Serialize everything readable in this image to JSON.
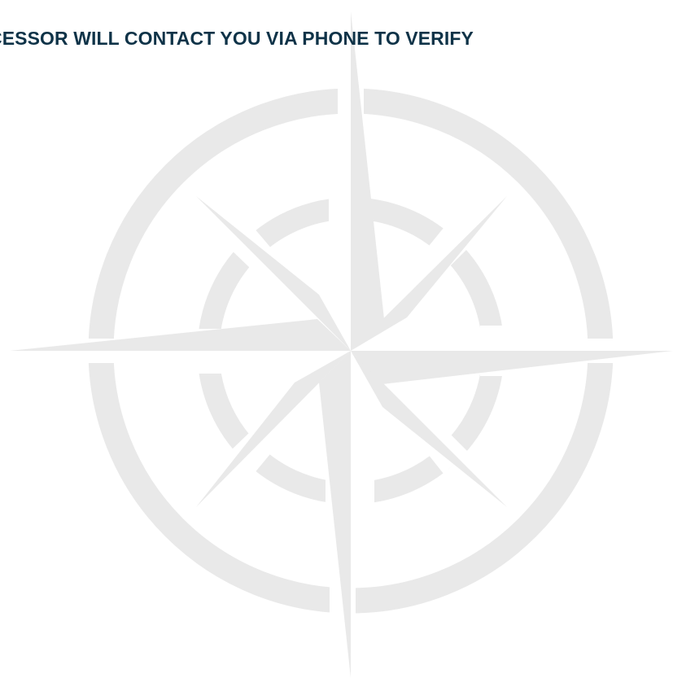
{
  "banner": {
    "text": "CESSOR WILL CONTACT YOU VIA PHONE TO VERIFY"
  },
  "watermark": {
    "icon": "compass-rose-icon"
  },
  "colors": {
    "banner_text": "#0f3348",
    "watermark": "#e9e9e9",
    "background": "#ffffff"
  }
}
